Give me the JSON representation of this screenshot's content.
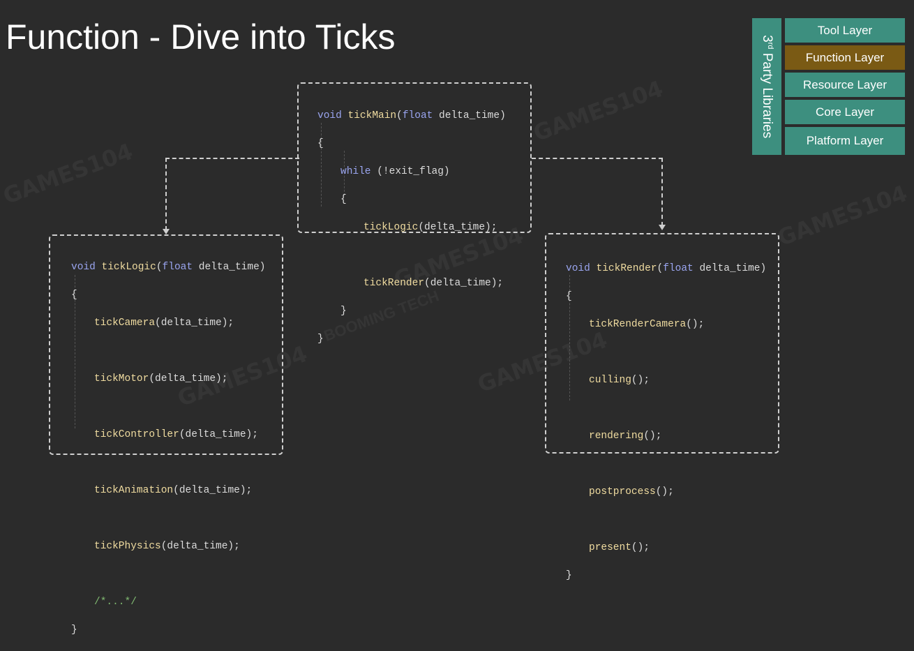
{
  "slide": {
    "title": "Function - Dive into Ticks",
    "watermarks": [
      "GAMES104",
      "BOOMING TECH"
    ]
  },
  "layers": {
    "side_label_prefix": "3",
    "side_label_sup": "rd",
    "side_label_rest": " Party Libraries",
    "items": [
      {
        "label": "Tool Layer"
      },
      {
        "label": "Function Layer"
      },
      {
        "label": "Resource Layer"
      },
      {
        "label": "Core Layer"
      },
      {
        "label": "Platform Layer"
      }
    ],
    "active": "Function Layer",
    "colors": {
      "layer": "#3d8f7f",
      "active": "#7a5a14"
    }
  },
  "tick_main": {
    "signature_void": "void",
    "signature_name": "tickMain",
    "signature_float": "float",
    "signature_param": " delta_time)",
    "open": "{",
    "while_kw": "while",
    "while_cond": " (!exit_flag)",
    "inner_open": "{",
    "call1_name": "tickLogic",
    "call1_args": "(delta_time);",
    "call2_name": "tickRender",
    "call2_args": "(delta_time);",
    "inner_close": "}",
    "close": "}"
  },
  "tick_logic": {
    "signature_void": "void",
    "signature_name": "tickLogic",
    "signature_float": "float",
    "signature_param": " delta_time)",
    "open": "{",
    "calls": [
      {
        "name": "tickCamera",
        "args": "(delta_time);"
      },
      {
        "name": "tickMotor",
        "args": "(delta_time);"
      },
      {
        "name": "tickController",
        "args": "(delta_time);"
      },
      {
        "name": "tickAnimation",
        "args": "(delta_time);"
      },
      {
        "name": "tickPhysics",
        "args": "(delta_time);"
      }
    ],
    "comment": "/*...*/",
    "close": "}"
  },
  "tick_render": {
    "signature_void": "void",
    "signature_name": "tickRender",
    "signature_float": "float",
    "signature_param": " delta_time)",
    "open": "{",
    "calls": [
      {
        "name": "tickRenderCamera",
        "args": "();"
      },
      {
        "name": "culling",
        "args": "();"
      },
      {
        "name": "rendering",
        "args": "();"
      },
      {
        "name": "postprocess",
        "args": "();"
      },
      {
        "name": "present",
        "args": "();"
      }
    ],
    "close": "}"
  }
}
